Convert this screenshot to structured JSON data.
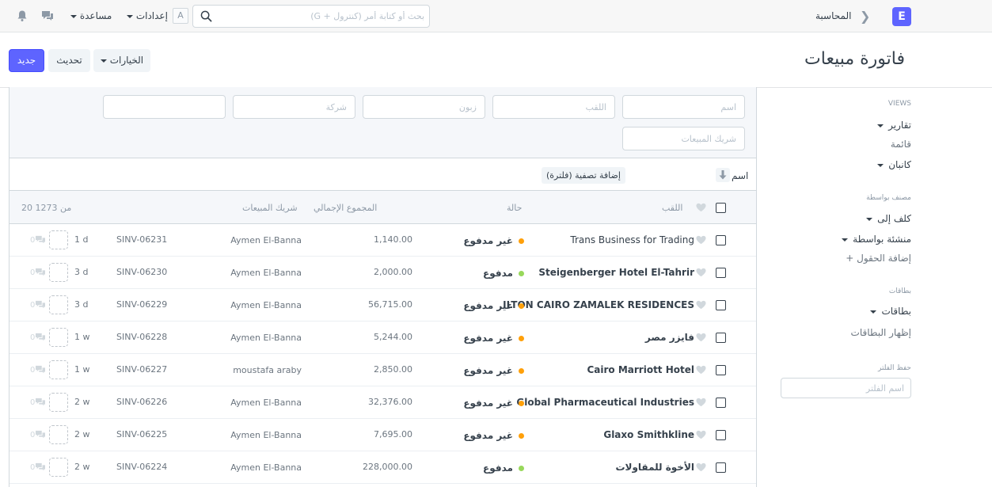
{
  "navbar": {
    "logo": "E",
    "breadcrumb": "المحاسبة",
    "search_placeholder": "بحث أو كتابة أمر (كنترول + G)",
    "avatar_initial": "A",
    "settings_label": "إعدادات",
    "help_label": "مساعدة"
  },
  "page": {
    "title": "فاتورة مبيعات",
    "new_button": "جديد",
    "refresh_button": "تحديث",
    "options_button": "الخيارات"
  },
  "sidebar": {
    "views_header": "VIEWS",
    "reports": "تقارير",
    "list": "قائمة",
    "kanban": "كانبان",
    "assigned_header": "مصنف بواسطة",
    "assigned_to": "كلف إلى",
    "created_by": "منشئة بواسطة",
    "add_fields": "إضافة الحقول",
    "tags_header": "بطاقات",
    "tags": "بطاقات",
    "show_tags": "إظهار البطاقات",
    "save_filter_header": "حفظ الفلتر",
    "filter_name_placeholder": "اسم الفلتر"
  },
  "filters": {
    "name_placeholder": "اسم",
    "title_placeholder": "اللقب",
    "customer_placeholder": "زبون",
    "company_placeholder": "شركة",
    "sales_partner_placeholder": "شريك المبيعات"
  },
  "sort": {
    "label": "اسم",
    "add_filter": "إضافة تصفية (فلترة)"
  },
  "list_header": {
    "title": "اللقب",
    "status": "حالة",
    "grand_total": "المجموع الإجمالي",
    "sales_partner": "شريك المبيعات",
    "count": "20 من 1273"
  },
  "rows": [
    {
      "title": "Trans Business for Trading",
      "bold": false,
      "status": "غير مدفوع",
      "status_color": "#ffa00a",
      "total": "1,140.00",
      "partner": "Aymen El-Banna",
      "id": "SINV-06231",
      "ago": "1 d",
      "comments": "0"
    },
    {
      "title": "Steigenberger Hotel El-Tahrir",
      "bold": true,
      "status": "مدفوع",
      "status_color": "#98d85b",
      "total": "2,000.00",
      "partner": "Aymen El-Banna",
      "id": "SINV-06230",
      "ago": "3 d",
      "comments": "0"
    },
    {
      "title": "ILTON CAIRO ZAMALEK RESIDENCES",
      "bold": true,
      "status": "غير مدفوع",
      "status_color": "#ffa00a",
      "total": "56,715.00",
      "partner": "Aymen El-Banna",
      "id": "SINV-06229",
      "ago": "3 d",
      "comments": "0"
    },
    {
      "title": "فايزر مصر",
      "bold": true,
      "status": "غير مدفوع",
      "status_color": "#ffa00a",
      "total": "5,244.00",
      "partner": "Aymen El-Banna",
      "id": "SINV-06228",
      "ago": "1 w",
      "comments": "0"
    },
    {
      "title": "Cairo Marriott Hotel",
      "bold": true,
      "status": "غير مدفوع",
      "status_color": "#ffa00a",
      "total": "2,850.00",
      "partner": "moustafa araby",
      "id": "SINV-06227",
      "ago": "1 w",
      "comments": "0"
    },
    {
      "title": "Global Pharmaceutical Industries",
      "bold": true,
      "status": "غير مدفوع",
      "status_color": "#ffa00a",
      "total": "32,376.00",
      "partner": "Aymen El-Banna",
      "id": "SINV-06226",
      "ago": "2 w",
      "comments": "0"
    },
    {
      "title": "Glaxo Smithkline",
      "bold": true,
      "status": "غير مدفوع",
      "status_color": "#ffa00a",
      "total": "7,695.00",
      "partner": "Aymen El-Banna",
      "id": "SINV-06225",
      "ago": "2 w",
      "comments": "0"
    },
    {
      "title": "الأخوة للمقاولات",
      "bold": true,
      "status": "مدفوع",
      "status_color": "#98d85b",
      "total": "228,000.00",
      "partner": "Aymen El-Banna",
      "id": "SINV-06224",
      "ago": "2 w",
      "comments": "0"
    }
  ]
}
